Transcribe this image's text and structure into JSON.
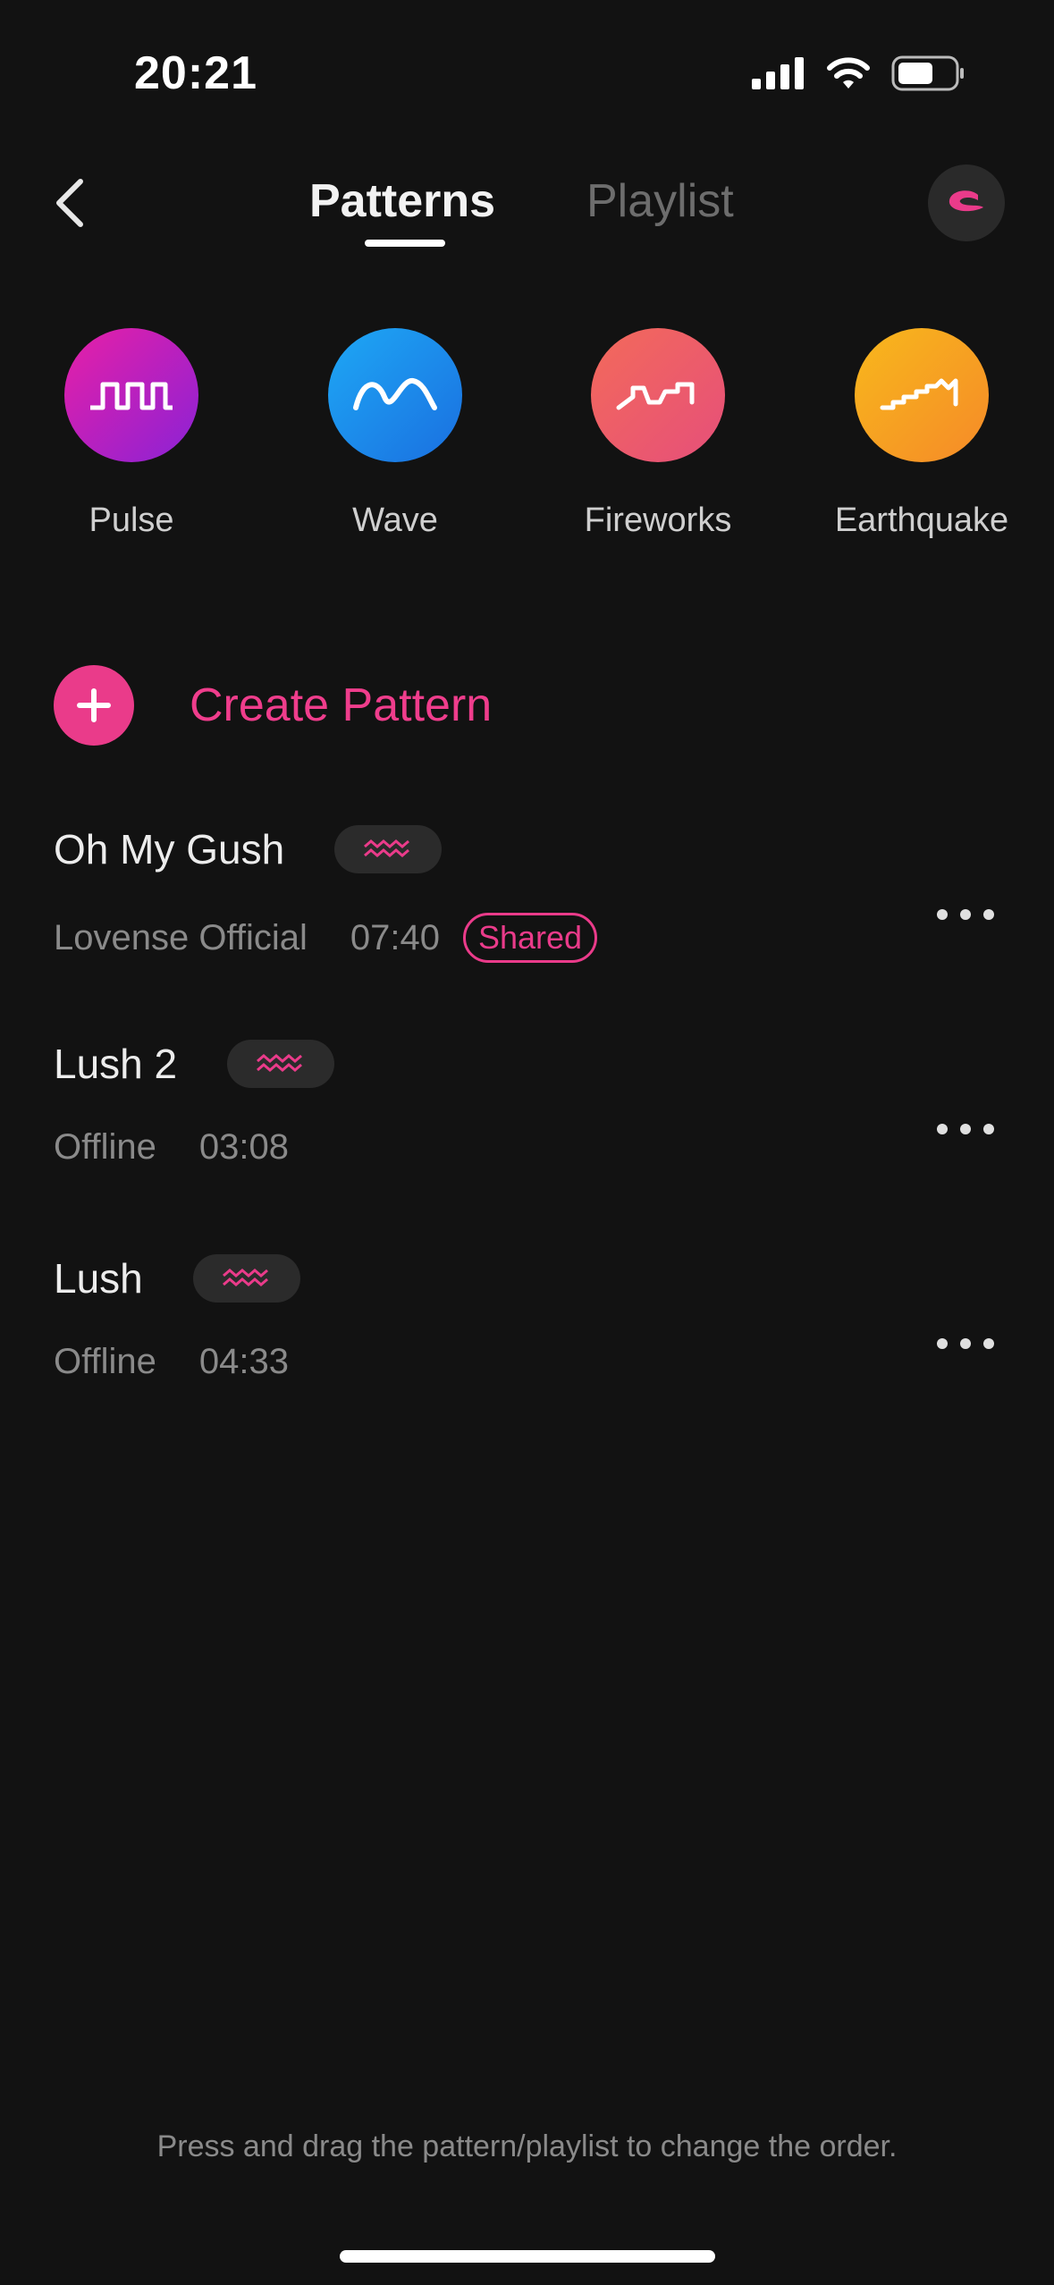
{
  "status_bar": {
    "time": "20:21",
    "icons": [
      "signal-icon",
      "wifi-icon",
      "battery-icon"
    ]
  },
  "header": {
    "back_icon": "chevron-left-icon",
    "tabs": [
      {
        "label": "Patterns",
        "active": true
      },
      {
        "label": "Playlist",
        "active": false
      }
    ],
    "device_icon": "device-logo-icon"
  },
  "presets": [
    {
      "label": "Pulse",
      "icon": "pulse-icon",
      "color_start": "#e81fa6",
      "color_end": "#8a22d6"
    },
    {
      "label": "Wave",
      "icon": "wave-icon",
      "color_start": "#1ea8f5",
      "color_end": "#1a6fe0"
    },
    {
      "label": "Fireworks",
      "icon": "fireworks-icon",
      "color_start": "#f36a5a",
      "color_end": "#e64f7a"
    },
    {
      "label": "Earthquake",
      "icon": "earthquake-icon",
      "color_start": "#f8b81c",
      "color_end": "#f58a28"
    }
  ],
  "create": {
    "label": "Create Pattern",
    "icon": "plus-icon"
  },
  "patterns": [
    {
      "title": "Oh My Gush",
      "author": "Lovense Official",
      "duration": "07:40",
      "badge": "Shared",
      "icon": "wave-lines-icon"
    },
    {
      "title": "Lush 2",
      "author": "Offline",
      "duration": "03:08",
      "badge": "",
      "icon": "wave-lines-icon"
    },
    {
      "title": "Lush",
      "author": "Offline",
      "duration": "04:33",
      "badge": "",
      "icon": "wave-lines-icon"
    }
  ],
  "hint": "Press and drag the pattern/playlist to change the order.",
  "colors": {
    "accent": "#ea3b8a",
    "background": "#121212"
  }
}
